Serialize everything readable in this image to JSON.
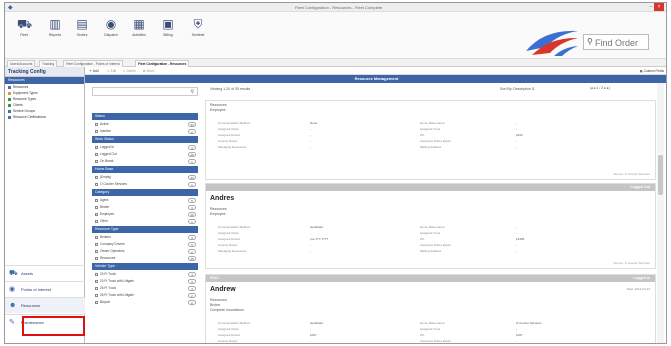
{
  "window": {
    "title": "Fleet Configuration - Resources - Fleet Complete"
  },
  "ribbon": {
    "buttons": [
      {
        "label": "Fleet",
        "icon": "map-icon"
      },
      {
        "label": "Reports",
        "icon": "chart-icon"
      },
      {
        "label": "Orders",
        "icon": "orders-icon"
      },
      {
        "label": "Dispatch",
        "icon": "dispatch-icon"
      },
      {
        "label": "Activities",
        "icon": "activities-icon"
      },
      {
        "label": "Billing",
        "icon": "billing-icon"
      },
      {
        "label": "Sentinel",
        "icon": "sentinel-icon"
      }
    ],
    "find_order_placeholder": "Find Order"
  },
  "tabs": [
    "Users/Accounts",
    "Tracking",
    "Fleet Configuration - Points of Interest",
    "Fleet Configuration - Resources"
  ],
  "sidebar": {
    "title": "Tracking Config",
    "section": "Resources",
    "items": [
      {
        "label": "Resources",
        "color": "#4a6fb5"
      },
      {
        "label": "Equipment Types",
        "color": "#d9a030"
      },
      {
        "label": "Resource Types",
        "color": "#3a9a3a"
      },
      {
        "label": "Clients",
        "color": "#3a9a3a"
      },
      {
        "label": "Service Groups",
        "color": "#4a6fb5"
      },
      {
        "label": "Resource Certifications",
        "color": "#4a6fb5"
      }
    ],
    "nav": [
      {
        "label": "Assets",
        "icon": "truck-icon"
      },
      {
        "label": "Points of Interest",
        "icon": "pin-icon"
      },
      {
        "label": "Resources",
        "icon": "people-icon"
      },
      {
        "label": "Maintenance",
        "icon": "wrench-icon"
      }
    ]
  },
  "toolbar": {
    "add": "Add",
    "edit": "Edit",
    "delete": "Delete",
    "move": "Move",
    "custom_fields": "Custom Fields"
  },
  "main": {
    "header": "Resource Management",
    "viewing": "Viewing 1-20 of 35 results",
    "sort_by": "Sort By: Description",
    "page": "1 / 2"
  },
  "filters": [
    {
      "header": "Status",
      "rows": [
        {
          "label": "Active",
          "count": "34"
        },
        {
          "label": "Inactive",
          "count": "2"
        }
      ]
    },
    {
      "header": "Work Status",
      "rows": [
        {
          "label": "Logged In",
          "count": "4"
        },
        {
          "label": "Logged Out",
          "count": "29"
        },
        {
          "label": "On Break",
          "count": "1"
        }
      ]
    },
    {
      "header": "Home Base",
      "rows": [
        {
          "label": "(Empty)",
          "count": "33"
        },
        {
          "label": "O Courier Services",
          "count": "1"
        }
      ]
    },
    {
      "header": "Category",
      "rows": [
        {
          "label": "Agent",
          "count": "5"
        },
        {
          "label": "Broker",
          "count": "3"
        },
        {
          "label": "Employee",
          "count": "26"
        },
        {
          "label": "Other",
          "count": "1"
        }
      ]
    },
    {
      "header": "Resource Type",
      "rows": [
        {
          "label": "Brokers",
          "count": "3"
        },
        {
          "label": "Company Drivers",
          "count": "5"
        },
        {
          "label": "Owner Operators",
          "count": "2"
        },
        {
          "label": "Resources",
          "count": "25"
        }
      ]
    },
    {
      "header": "Vehicle Type",
      "rows": [
        {
          "label": "20 Ft Truck",
          "count": "4"
        },
        {
          "label": "20 Ft Truck with Liftgate",
          "count": "3"
        },
        {
          "label": "26 Ft Truck",
          "count": "4"
        },
        {
          "label": "26 Ft Truck with Liftgate",
          "count": "2"
        },
        {
          "label": "Bicycle",
          "count": "2"
        }
      ]
    }
  ],
  "cards": [
    {
      "status": "",
      "name": "",
      "category": "Resources",
      "role": "Employee",
      "fields_left": [
        {
          "k": "Communication Method",
          "v": "None"
        },
        {
          "k": "Assigned Asset",
          "v": "-"
        },
        {
          "k": "Assigned Device",
          "v": "-"
        },
        {
          "k": "License Expiry",
          "v": "-"
        },
        {
          "k": "Managing Resources",
          "v": "-"
        }
      ],
      "fields_right": [
        {
          "k": "Home Base Name",
          "v": "-"
        },
        {
          "k": "Assigned Crew",
          "v": "-"
        },
        {
          "k": "Pin",
          "v": "2222"
        },
        {
          "k": "Insurance Policy Expiry",
          "v": "-"
        },
        {
          "k": "Mailing Address",
          "v": "-"
        }
      ],
      "source": "Source: O Courier Services"
    },
    {
      "status": "Logged Out",
      "name": "Andres",
      "category": "Resources",
      "role": "Employee",
      "fields_left": [
        {
          "k": "Communication Method",
          "v": "Handheld"
        },
        {
          "k": "Assigned Asset",
          "v": "-"
        },
        {
          "k": "Assigned Device",
          "v": "xxx-777-7777"
        },
        {
          "k": "License Expiry",
          "v": "-"
        },
        {
          "k": "Managing Resources",
          "v": "-"
        }
      ],
      "fields_right": [
        {
          "k": "Home Base Name",
          "v": "-"
        },
        {
          "k": "Assigned Crew",
          "v": "-"
        },
        {
          "k": "Pin",
          "v": "12456"
        },
        {
          "k": "Insurance Policy Expiry",
          "v": "-"
        },
        {
          "k": "Mailing Address",
          "v": "-"
        }
      ],
      "source": "Source: O Courier Services"
    },
    {
      "status": "Logged In",
      "tag": "POCI",
      "name": "Andrew",
      "category": "Resources",
      "role": "Broker",
      "company": "Complete Innovations",
      "date": "Start: 2014-04-24",
      "fields_left": [
        {
          "k": "Communication Method",
          "v": "Handheld"
        },
        {
          "k": "Assigned Asset",
          "v": "-"
        },
        {
          "k": "Assigned Device",
          "v": "1007"
        },
        {
          "k": "License Expiry",
          "v": "-"
        }
      ],
      "fields_right": [
        {
          "k": "Home Base Name",
          "v": "O Courier Services"
        },
        {
          "k": "Assigned Crew",
          "v": "-"
        },
        {
          "k": "Pin",
          "v": "1007"
        },
        {
          "k": "Insurance Policy Expiry",
          "v": "-"
        }
      ]
    }
  ]
}
